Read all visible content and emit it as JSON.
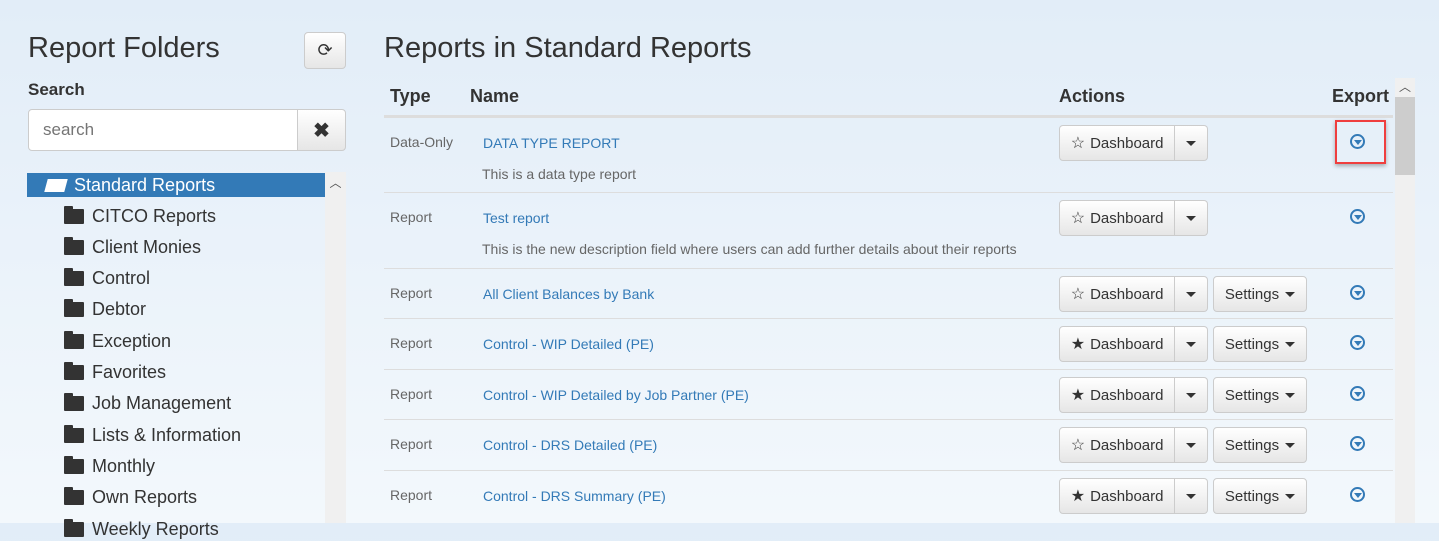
{
  "left": {
    "title": "Report Folders",
    "refresh_icon": "refresh-icon",
    "search_label": "Search",
    "search_placeholder": "search",
    "search_value": "",
    "clear_icon": "close-icon",
    "root": "Standard Reports",
    "folders": [
      "CITCO Reports",
      "Client Monies",
      "Control",
      "Debtor",
      "Exception",
      "Favorites",
      "Job Management",
      "Lists & Information",
      "Monthly",
      "Own Reports",
      "Weekly Reports"
    ]
  },
  "main": {
    "title": "Reports in Standard Reports",
    "columns": {
      "type": "Type",
      "name": "Name",
      "actions": "Actions",
      "export": "Export"
    },
    "dashboard_label": "Dashboard",
    "settings_label": "Settings",
    "rows": [
      {
        "type": "Data-Only",
        "name": "DATA TYPE REPORT",
        "description": "This is a data type report",
        "favorite": false,
        "settings": false,
        "highlighted_export": true
      },
      {
        "type": "Report",
        "name": "Test report",
        "description": "This is the new description field where users can add further details about their reports",
        "favorite": false,
        "settings": false
      },
      {
        "type": "Report",
        "name": "All Client Balances by Bank",
        "favorite": false,
        "settings": true
      },
      {
        "type": "Report",
        "name": "Control - WIP Detailed (PE)",
        "favorite": true,
        "settings": true
      },
      {
        "type": "Report",
        "name": "Control - WIP Detailed by Job Partner (PE)",
        "favorite": true,
        "settings": true
      },
      {
        "type": "Report",
        "name": "Control - DRS Detailed (PE)",
        "favorite": false,
        "settings": true
      },
      {
        "type": "Report",
        "name": "Control - DRS Summary (PE)",
        "favorite": true,
        "settings": true
      }
    ]
  },
  "colors": {
    "accent": "#337ab7",
    "highlight": "#ef3e3e"
  }
}
